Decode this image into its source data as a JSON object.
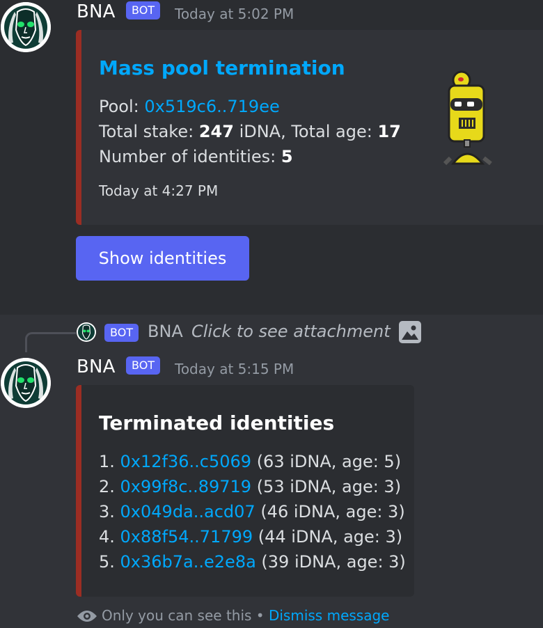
{
  "message1": {
    "username": "BNA",
    "badge": "BOT",
    "timestamp": "Today at 5:02 PM",
    "embed": {
      "title": "Mass pool termination",
      "pool_label": "Pool: ",
      "pool_address": "0x519c6..719ee",
      "stake_label": "Total stake: ",
      "stake_value": "247",
      "stake_unit": " iDNA, Total age: ",
      "age_value": "17",
      "identities_label": "Number of identities: ",
      "identities_value": "5",
      "footer_timestamp": "Today at 4:27 PM"
    },
    "button_label": "Show identities"
  },
  "reply": {
    "badge": "BOT",
    "username": "BNA",
    "text": "Click to see attachment"
  },
  "message2": {
    "username": "BNA",
    "badge": "BOT",
    "timestamp": "Today at 5:15 PM",
    "embed": {
      "title": "Terminated identities",
      "items": [
        {
          "num": "1. ",
          "address": "0x12f36..c5069",
          "detail": " (63 iDNA, age: 5)"
        },
        {
          "num": "2. ",
          "address": "0x99f8c..89719",
          "detail": " (53 iDNA, age: 3)"
        },
        {
          "num": "3. ",
          "address": "0x049da..acd07",
          "detail": " (46 iDNA, age: 3)"
        },
        {
          "num": "4. ",
          "address": "0x88f54..71799",
          "detail": " (44 iDNA, age: 3)"
        },
        {
          "num": "5. ",
          "address": "0x36b7a..e2e8a",
          "detail": " (39 iDNA, age: 3)"
        }
      ]
    }
  },
  "ephemeral": {
    "text": "Only you can see this",
    "separator": " • ",
    "dismiss": "Dismiss message"
  },
  "colors": {
    "background": "#313338",
    "highlight": "#2b2d31",
    "blurple": "#5865f2",
    "link": "#00a8fc",
    "embed_border": "#9b2d23"
  },
  "icons": [
    "avatar-face-icon",
    "robot-thumbnail-icon",
    "image-attachment-icon",
    "eye-icon"
  ]
}
